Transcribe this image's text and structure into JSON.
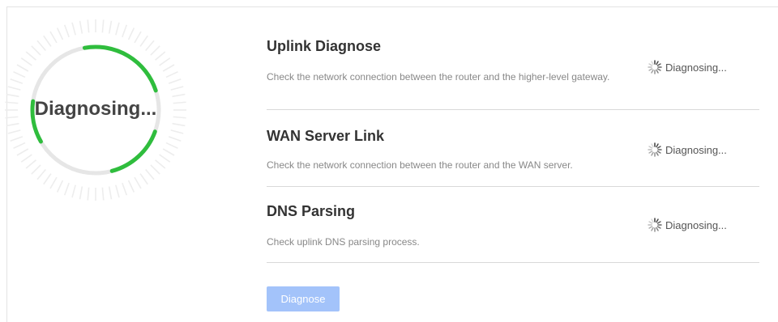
{
  "gauge": {
    "label": "Diagnosing...",
    "progress_color": "#2fbd3d",
    "track_color": "#e6e6e6",
    "tick_color": "#ededed"
  },
  "items": [
    {
      "title": "Uplink Diagnose",
      "description": "Check the network connection between the router and the higher-level gateway.",
      "status": "Diagnosing...",
      "status_icon": "spinner-icon"
    },
    {
      "title": "WAN Server Link",
      "description": "Check the network connection between the router and the WAN server.",
      "status": "Diagnosing...",
      "status_icon": "spinner-icon"
    },
    {
      "title": "DNS Parsing",
      "description": "Check uplink DNS parsing process.",
      "status": "Diagnosing...",
      "status_icon": "spinner-icon"
    }
  ],
  "diagnose_button": {
    "label": "Diagnose",
    "color": "#a3c3fa",
    "disabled": true
  }
}
